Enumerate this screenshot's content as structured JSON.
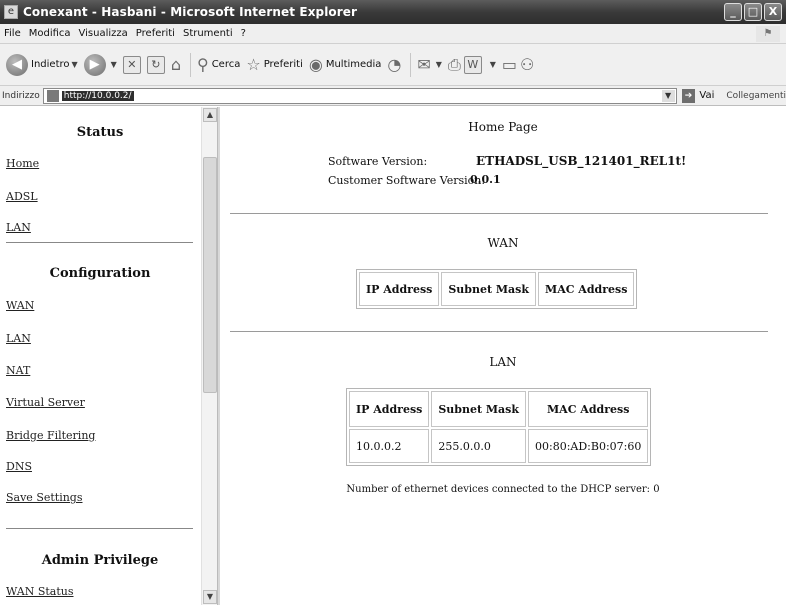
{
  "window": {
    "title": "Conexant - Hasbani - Microsoft Internet Explorer",
    "buttons": [
      "_",
      "□",
      "X"
    ]
  },
  "menu": [
    "File",
    "Modifica",
    "Visualizza",
    "Preferiti",
    "Strumenti",
    "?"
  ],
  "toolbar": {
    "back_label": "Indietro",
    "search_label": "Cerca",
    "favorites_label": "Preferiti",
    "media_label": "Multimedia"
  },
  "address": {
    "label": "Indirizzo",
    "url": "http://10.0.0.2/",
    "go_label": "Vai",
    "links_label": "Collegamenti"
  },
  "sidebar": {
    "status_title": "Status",
    "status_links": [
      "Home",
      "ADSL",
      "LAN"
    ],
    "config_title": "Configuration",
    "config_links": [
      "WAN",
      "LAN",
      "NAT",
      "Virtual Server",
      "Bridge Filtering",
      "DNS",
      "Save Settings"
    ],
    "admin_title": "Admin Privilege",
    "admin_links": [
      "WAN Status"
    ]
  },
  "main": {
    "page_title": "Home Page",
    "software_version_label": "Software Version:",
    "software_version_value": "ETHADSL_USB_121401_REL1t!",
    "customer_version_label": "Customer Software Version:",
    "customer_version_value": "0.0.1",
    "wan": {
      "heading": "WAN",
      "headers": [
        "IP Address",
        "Subnet Mask",
        "MAC Address"
      ]
    },
    "lan": {
      "heading": "LAN",
      "headers": [
        "IP Address",
        "Subnet Mask",
        "MAC Address"
      ],
      "rows": [
        [
          "10.0.0.2",
          "255.0.0.0",
          "00:80:AD:B0:07:60"
        ]
      ]
    },
    "dhcp_note": "Number of ethernet devices connected to the DHCP server: 0"
  }
}
